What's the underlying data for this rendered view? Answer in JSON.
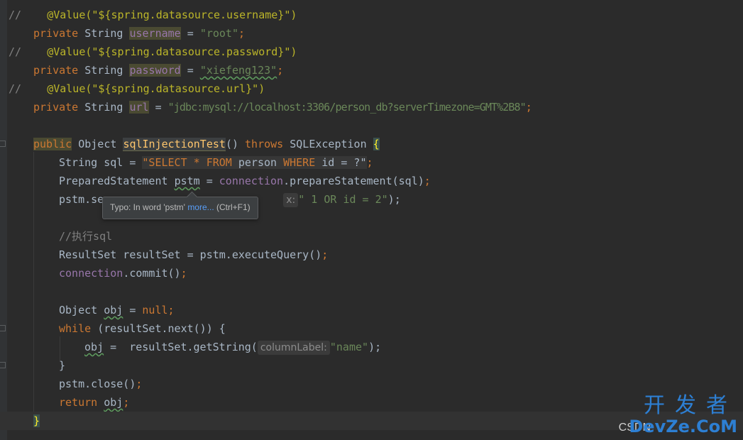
{
  "code": {
    "l1": {
      "c": "//",
      "a": "@Value(\"${spring.datasource.username}\")"
    },
    "l2": {
      "k": "private",
      "t": "String",
      "v": "username",
      "eq": "=",
      "s": "\"root\"",
      "semi": ";"
    },
    "l3": {
      "c": "//",
      "a": "@Value(\"${spring.datasource.password}\")"
    },
    "l4": {
      "k": "private",
      "t": "String",
      "v": "password",
      "eq": "=",
      "s": "\"xiefeng123\"",
      "semi": ";"
    },
    "l5": {
      "c": "//",
      "a": "@Value(\"${spring.datasource.url}\")"
    },
    "l6": {
      "k": "private",
      "t": "String",
      "v": "url",
      "eq": "=",
      "s": "\"jdbc:mysql://localhost:3306/person_db?serverTimezone=GMT%2B8\"",
      "semi": ";"
    },
    "l8": {
      "k": "public",
      "t": "Object",
      "fn": "sqlInjectionTest",
      "p": "()",
      "th": "throws",
      "ex": "SQLException",
      "br": "{"
    },
    "l9": {
      "t": "String sql =",
      "s1": "\"SELECT * FROM ",
      "s2": "person",
      "s3": " WHERE ",
      "s4": "id = ?\"",
      "semi": ";"
    },
    "l10": {
      "t": "PreparedStatement",
      "v": "pstm",
      "eq": "=",
      "f": "connection",
      "m": ".prepareStatement(sql)",
      "semi": ";"
    },
    "l11": {
      "a": "pstm.se",
      "hint": "x:",
      "s": "\" 1 OR id = 2\"",
      "e": ");"
    },
    "l13": {
      "c": "//执行sql"
    },
    "l14": {
      "t": "ResultSet resultSet = pstm.executeQuery()",
      "semi": ";"
    },
    "l15": {
      "f": "connection",
      "m": ".commit()",
      "semi": ";"
    },
    "l17": {
      "t": "Object",
      "v": "obj",
      "eq": "=",
      "k": "null",
      "semi": ";"
    },
    "l18": {
      "k": "while",
      "r": "(resultSet.next()) {"
    },
    "l19": {
      "v": "obj",
      "m": " =  resultSet.getString(",
      "hint": "columnLabel:",
      "s": "\"name\"",
      "e": ");"
    },
    "l20": {
      "t": "}"
    },
    "l21": {
      "t": "pstm.close()",
      "semi": ";"
    },
    "l22": {
      "k": "return",
      "v": "obj",
      "semi": ";"
    },
    "l23": {
      "br": "}"
    }
  },
  "tooltip": {
    "text": "Typo: In word 'pstm'",
    "link": "more...",
    "shortcut": "(Ctrl+F1)"
  },
  "watermark": {
    "cn": "开发者",
    "en": "DevZe.CoM",
    "csdn": "CSDN"
  },
  "colors": {
    "background": "#2b2b2b",
    "keyword": "#cc7832",
    "string": "#6a8759",
    "field": "#9876aa",
    "method": "#ffc66d",
    "comment": "#808080",
    "annotation": "#bbb529"
  }
}
